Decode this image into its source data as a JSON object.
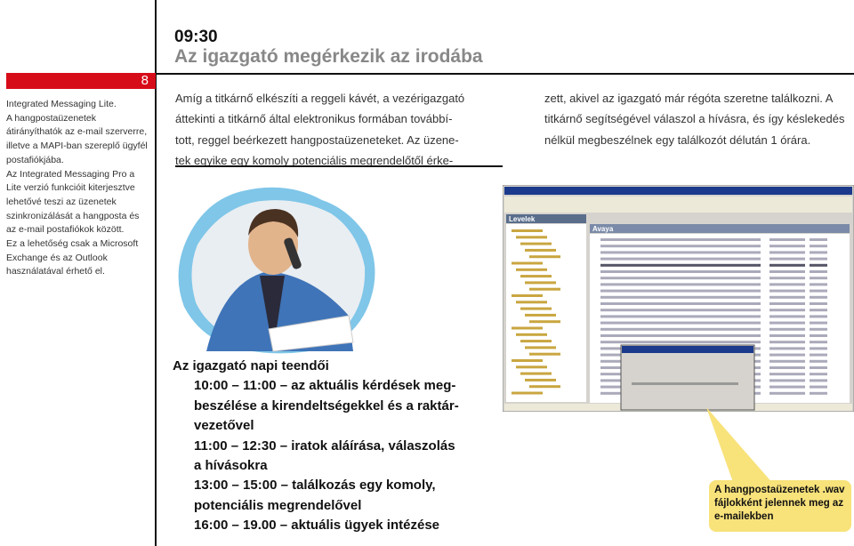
{
  "page_number": "8",
  "sidebar_text": "Integrated Messaging Lite.\nA hangpostaüzenetek\nátirányíthatók az e-mail szerverre,\nilletve a MAPI-ban szereplő ügyfél\npostafiókjába.\nAz Integrated Messaging Pro a\nLite verzió funkcióit kiterjesztve\nlehetővé teszi az üzenetek\nszinkronizálását a hangposta és\naz e-mail postafiókok között.\nEz a lehetőség csak a Microsoft\nExchange és az Outlook\nhasználatával érhető el.",
  "header": {
    "time": "09:30",
    "title": "Az igazgató megérkezik az irodába"
  },
  "body_col1": [
    "Amíg a titkárnő elkészíti a reggeli kávét, a vezérigazgató",
    "áttekinti a titkárnő által elektronikus formában továbbí-",
    "tott, reggel beérkezett hangpostaüzeneteket. Az üzene-",
    "tek egyike egy komoly potenciális megrendelőtől érke-"
  ],
  "body_col2": [
    "zett, akivel az igazgató már régóta szeretne találkozni. A",
    "titkárnő segítségével válaszol a hívásra, és így késlekedés",
    "nélkül megbeszélnek egy találkozót délután 1 órára."
  ],
  "schedule": {
    "heading": "Az igazgató napi teendői",
    "lines": [
      "10:00 – 11:00 – az aktuális kérdések meg-",
      "beszélése a kirendeltségekkel és a raktár-",
      "vezetővel",
      "11:00 – 12:30 – iratok aláírása, válaszolás",
      "a hívásokra",
      "13:00 – 15:00 – találkozás egy komoly,",
      "potenciális megrendelővel",
      "16:00 – 19.00 – aktuális ügyek intézése"
    ]
  },
  "screenshot": {
    "pane_label": "Levelek",
    "folder_title": "Avaya"
  },
  "callout": "A hangpostaüzenetek .wav fájlokként jelennek meg az e-mailekben",
  "colors": {
    "accent_red": "#d70c19",
    "callout_yellow": "#f8e27a",
    "title_gray": "#888888"
  }
}
